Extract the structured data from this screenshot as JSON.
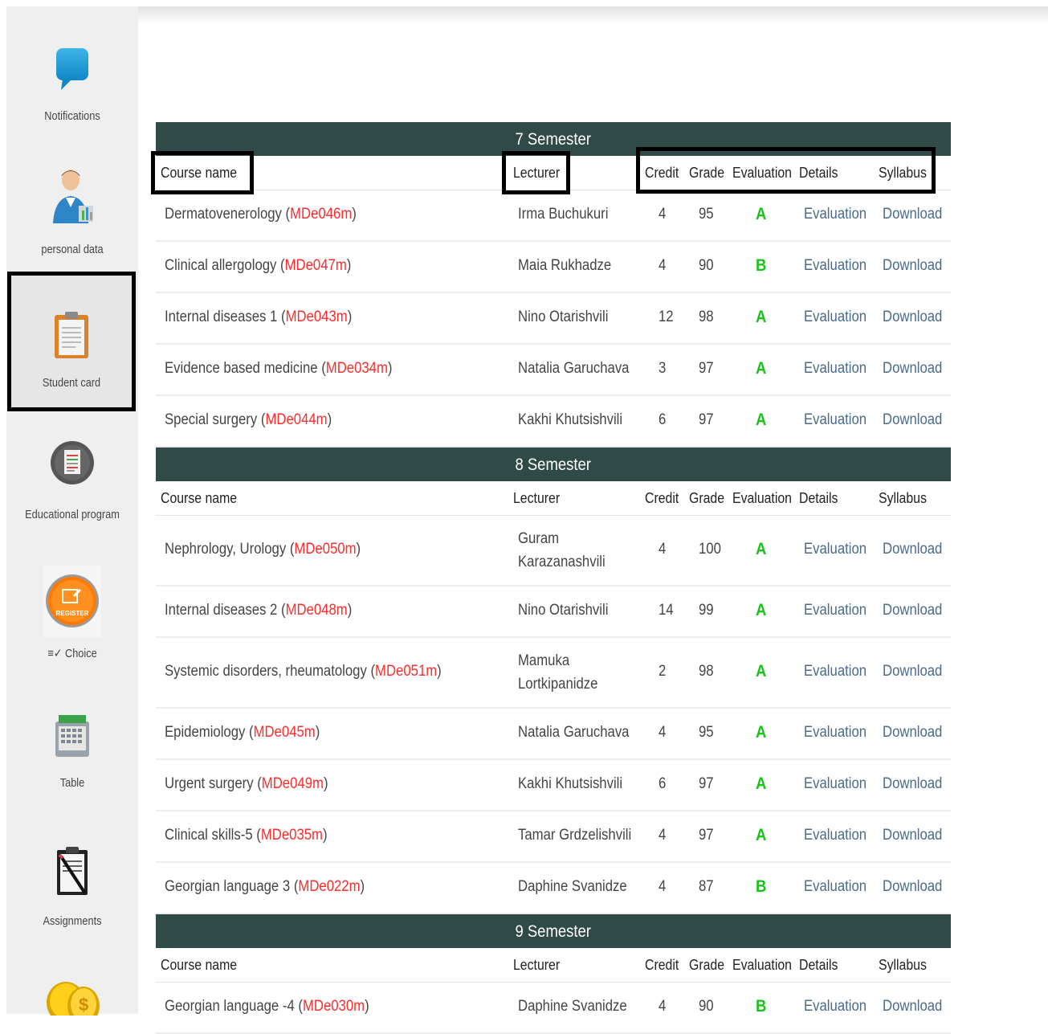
{
  "sidebar": {
    "items": [
      {
        "label": "Notifications",
        "icon": "speech-bubble-icon"
      },
      {
        "label": "personal data",
        "icon": "user-avatar-icon"
      },
      {
        "label": "Student card",
        "icon": "clipboard-icon",
        "selected": true
      },
      {
        "label": "Educational program",
        "icon": "document-circle-icon"
      },
      {
        "label": "Choice",
        "icon": "register-icon",
        "badge_text": "REGISTER"
      },
      {
        "label": "Table",
        "icon": "calculator-table-icon"
      },
      {
        "label": "Assignments",
        "icon": "assignment-clipboard-icon"
      },
      {
        "label": "",
        "icon": "coins-icon"
      }
    ]
  },
  "columns": {
    "course": "Course name",
    "lecturer": "Lecturer",
    "credit": "Credit",
    "grade": "Grade",
    "evaluation": "Evaluation",
    "details": "Details",
    "syllabus": "Syllabus"
  },
  "semesters": [
    {
      "title": "7 Semester",
      "courses": [
        {
          "name": "Dermatovenerology",
          "code": "MDe046m",
          "lecturer": [
            "Irma Buchukuri"
          ],
          "credit": "4",
          "grade": "95",
          "evaluation": "A",
          "details": "Evaluation",
          "syllabus": "Download"
        },
        {
          "name": "Clinical allergology",
          "code": "MDe047m",
          "lecturer": [
            "Maia Rukhadze"
          ],
          "credit": "4",
          "grade": "90",
          "evaluation": "B",
          "details": "Evaluation",
          "syllabus": "Download"
        },
        {
          "name": "Internal diseases 1",
          "code": "MDe043m",
          "lecturer": [
            "Nino Otarishvili"
          ],
          "credit": "12",
          "grade": "98",
          "evaluation": "A",
          "details": "Evaluation",
          "syllabus": "Download"
        },
        {
          "name": "Evidence based medicine",
          "code": "MDe034m",
          "lecturer": [
            "Natalia Garuchava"
          ],
          "credit": "3",
          "grade": "97",
          "evaluation": "A",
          "details": "Evaluation",
          "syllabus": "Download"
        },
        {
          "name": "Special surgery",
          "code": "MDe044m",
          "lecturer": [
            "Kakhi Khutsishvili"
          ],
          "credit": "6",
          "grade": "97",
          "evaluation": "A",
          "details": "Evaluation",
          "syllabus": "Download"
        }
      ]
    },
    {
      "title": "8 Semester",
      "courses": [
        {
          "name": "Nephrology, Urology",
          "code": "MDe050m",
          "lecturer": [
            "Guram",
            "Karazanashvili"
          ],
          "credit": "4",
          "grade": "100",
          "evaluation": "A",
          "details": "Evaluation",
          "syllabus": "Download"
        },
        {
          "name": "Internal diseases 2",
          "code": "MDe048m",
          "lecturer": [
            "Nino Otarishvili"
          ],
          "credit": "14",
          "grade": "99",
          "evaluation": "A",
          "details": "Evaluation",
          "syllabus": "Download"
        },
        {
          "name": "Systemic disorders, rheumatology",
          "code": "MDe051m",
          "lecturer": [
            "Mamuka",
            "Lortkipanidze"
          ],
          "credit": "2",
          "grade": "98",
          "evaluation": "A",
          "details": "Evaluation",
          "syllabus": "Download"
        },
        {
          "name": "Epidemiology",
          "code": "MDe045m",
          "lecturer": [
            "Natalia Garuchava"
          ],
          "credit": "4",
          "grade": "95",
          "evaluation": "A",
          "details": "Evaluation",
          "syllabus": "Download"
        },
        {
          "name": "Urgent surgery",
          "code": "MDe049m",
          "lecturer": [
            "Kakhi Khutsishvili"
          ],
          "credit": "6",
          "grade": "97",
          "evaluation": "A",
          "details": "Evaluation",
          "syllabus": "Download"
        },
        {
          "name": "Clinical skills-5",
          "code": "MDe035m",
          "lecturer": [
            "Tamar Grdzelishvili"
          ],
          "credit": "4",
          "grade": "97",
          "evaluation": "A",
          "details": "Evaluation",
          "syllabus": "Download"
        },
        {
          "name": "Georgian language 3",
          "code": "MDe022m",
          "lecturer": [
            "Daphine Svanidze"
          ],
          "credit": "4",
          "grade": "87",
          "evaluation": "B",
          "details": "Evaluation",
          "syllabus": "Download"
        }
      ]
    },
    {
      "title": "9 Semester",
      "courses": [
        {
          "name": "Georgian language -4",
          "code": "MDe030m",
          "lecturer": [
            "Daphine Svanidze"
          ],
          "credit": "4",
          "grade": "90",
          "evaluation": "B",
          "details": "Evaluation",
          "syllabus": "Download"
        }
      ]
    }
  ],
  "colors": {
    "semester_header": "#2f4a47",
    "course_code": "#ff2b2b",
    "evaluation_grade": "#19c219",
    "link": "#4a6a8a"
  }
}
